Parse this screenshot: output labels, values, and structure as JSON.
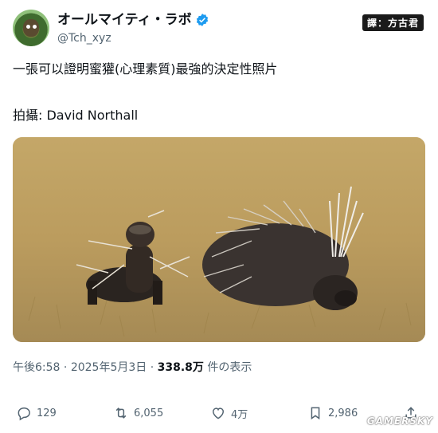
{
  "author": {
    "display_name": "オールマイティ・ラボ",
    "handle": "@Tch_xyz"
  },
  "translator_tag": "譯：方古君",
  "post": {
    "text": "一張可以證明蜜獾(心理素質)最強的決定性照片",
    "photo_credit": "拍攝: David Northall"
  },
  "meta": {
    "time": "午後6:58",
    "date": "2025年5月3日",
    "separator": "·",
    "views_count": "338.8万",
    "views_label": "件の表示"
  },
  "actions": {
    "replies": "129",
    "reposts": "6,055",
    "likes": "4万",
    "bookmarks": "2,986"
  },
  "watermark": "GAMERSKY",
  "colors": {
    "verified_blue": "#1d9bf0",
    "secondary_text": "#536471",
    "primary_text": "#0f1419"
  },
  "icons": [
    "verified-icon",
    "reply-icon",
    "repost-icon",
    "like-icon",
    "bookmark-icon",
    "share-icon"
  ]
}
